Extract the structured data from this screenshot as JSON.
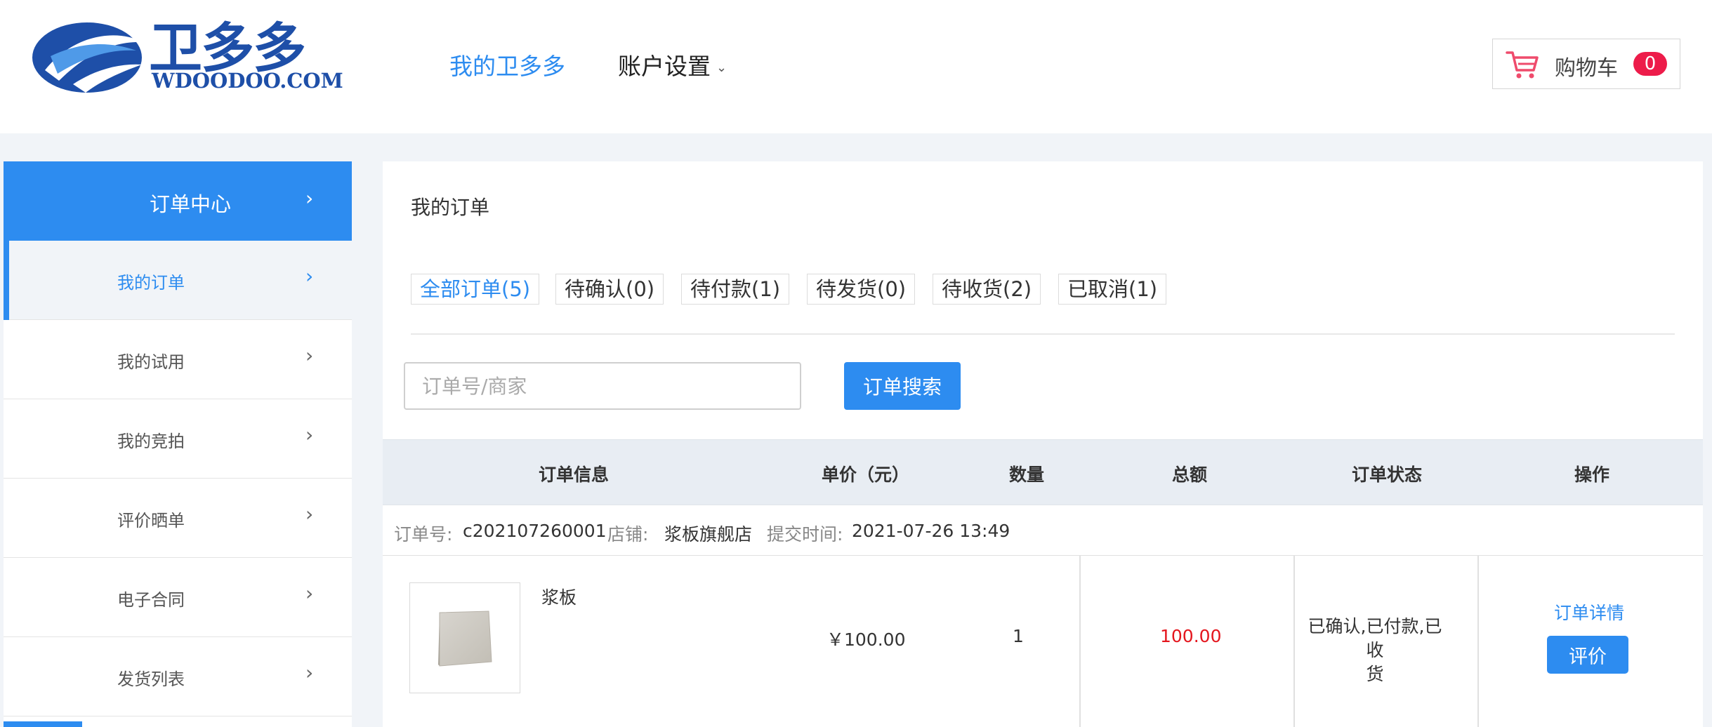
{
  "brand": {
    "name_cn": "卫多多",
    "name_en": "WDOODOO.COM",
    "color": "#1e4fa8"
  },
  "nav": {
    "home_label": "我的卫多多",
    "account_label": "账户设置",
    "account_icon": "chevron-down-icon"
  },
  "cart": {
    "label": "购物车",
    "count": "0",
    "icon": "cart-icon"
  },
  "sidebar": {
    "header": {
      "label": "订单中心",
      "icon": "chevron-right-icon"
    },
    "items": [
      {
        "label": "我的订单",
        "active": true
      },
      {
        "label": "我的试用"
      },
      {
        "label": "我的竞拍"
      },
      {
        "label": "评价晒单"
      },
      {
        "label": "电子合同"
      },
      {
        "label": "发货列表"
      }
    ]
  },
  "main": {
    "title": "我的订单",
    "tabs": [
      {
        "label": "全部订单(5)",
        "active": true
      },
      {
        "label": "待确认(0)"
      },
      {
        "label": "待付款(1)"
      },
      {
        "label": "待发货(0)"
      },
      {
        "label": "待收货(2)"
      },
      {
        "label": "已取消(1)"
      }
    ],
    "search": {
      "placeholder": "订单号/商家",
      "button_label": "订单搜索"
    },
    "table": {
      "headers": [
        "订单信息",
        "单价（元）",
        "数量",
        "总额",
        "订单状态",
        "操作"
      ]
    },
    "orders": [
      {
        "order_no_label": "订单号:",
        "order_no": "c202107260001",
        "shop_label": "店铺:",
        "shop": "浆板旗舰店",
        "time_label": "提交时间:",
        "time": "2021-07-26 13:49",
        "product_name": "浆板",
        "unit_price": "￥100.00",
        "quantity": "1",
        "total": "100.00",
        "status_line1": "已确认,已付款,已收",
        "status_line2": "货",
        "detail_link": "订单详情",
        "review_button": "评价"
      }
    ]
  },
  "colors": {
    "accent": "#2d8cf0",
    "price_red": "#e4161e",
    "badge_red": "#ed1c4a",
    "page_bg": "#f1f4f8"
  }
}
